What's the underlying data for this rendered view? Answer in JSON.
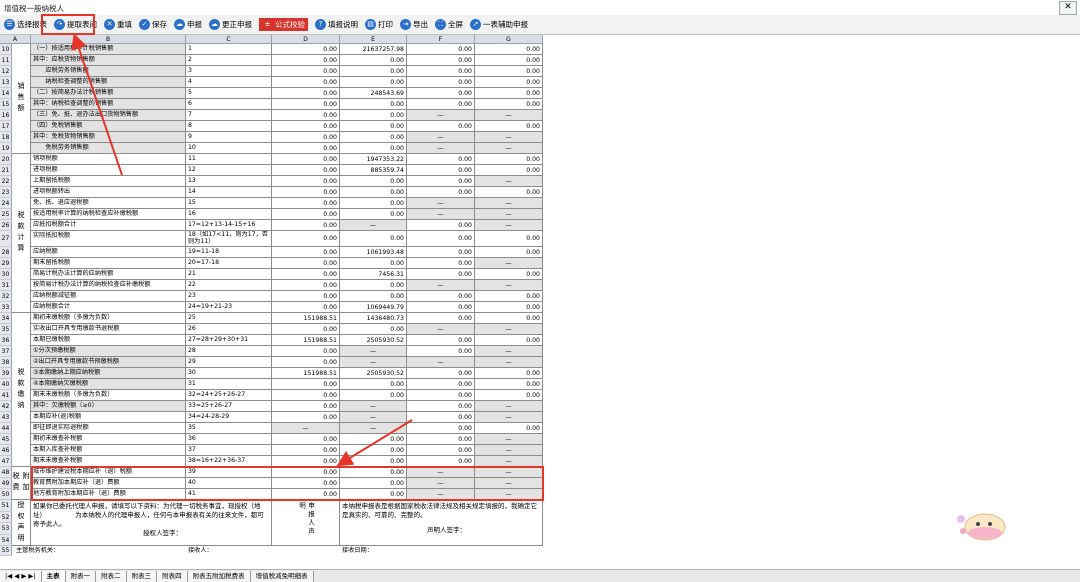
{
  "window": {
    "title": "增值税一般纳税人",
    "close_glyph": "✕"
  },
  "toolbar": [
    {
      "name": "select-report-button",
      "label": "选择报表",
      "icon": "list-icon",
      "color": "#2a6fc9"
    },
    {
      "name": "fetch-report-button",
      "label": "提取表间",
      "icon": "share-arrow-icon",
      "color": "#2a6fc9"
    },
    {
      "name": "refill-button",
      "label": "重填",
      "icon": "close-circle-icon",
      "color": "#2a6fc9"
    },
    {
      "name": "save-button",
      "label": "保存",
      "icon": "check-circle-icon",
      "color": "#2a6fc9"
    },
    {
      "name": "declare-button",
      "label": "申报",
      "icon": "cloud-icon",
      "color": "#2a6fc9"
    },
    {
      "name": "correct-declare-button",
      "label": "更正申报",
      "icon": "cloud-icon",
      "color": "#2a6fc9"
    },
    {
      "name": "formula-check-button",
      "label": "公式校验",
      "icon": "formula-icon",
      "color": "#d9342b"
    },
    {
      "name": "fill-help-button",
      "label": "填报说明",
      "icon": "question-icon",
      "color": "#2a6fc9"
    },
    {
      "name": "print-button",
      "label": "打印",
      "icon": "printer-icon",
      "color": "#2a6fc9"
    },
    {
      "name": "export-button",
      "label": "导出",
      "icon": "export-icon",
      "color": "#2a6fc9"
    },
    {
      "name": "fullscreen-button",
      "label": "全屏",
      "icon": "fullscreen-icon",
      "color": "#2a6fc9"
    },
    {
      "name": "auxiliary-declare-button",
      "label": "一表辅助申报",
      "icon": "expand-icon",
      "color": "#2a6fc9"
    }
  ],
  "columns": [
    "A",
    "B",
    "C",
    "D",
    "E",
    "F",
    "G"
  ],
  "categories": [
    {
      "label": "销售额",
      "from": 0,
      "to": 9
    },
    {
      "label": "税款计算",
      "from": 10,
      "to": 23
    },
    {
      "label": "税款缴纳",
      "from": 24,
      "to": 37
    },
    {
      "label": "附加税费",
      "from": 38,
      "to": 40
    }
  ],
  "rows": [
    {
      "n": "10",
      "b": "（一）按适用税率计税销售额",
      "c": "1",
      "d": "0.00",
      "e": "21637257.98",
      "f": "0.00",
      "g": "0.00"
    },
    {
      "n": "11",
      "b": "其中：应税货物销售额",
      "c": "2",
      "d": "0.00",
      "e": "0.00",
      "f": "0.00",
      "g": "0.00"
    },
    {
      "n": "12",
      "b": "　　应税劳务销售额",
      "c": "3",
      "d": "0.00",
      "e": "0.00",
      "f": "0.00",
      "g": "0.00"
    },
    {
      "n": "13",
      "b": "　　纳税检查调整的销售额",
      "c": "4",
      "d": "0.00",
      "e": "0.00",
      "f": "0.00",
      "g": "0.00"
    },
    {
      "n": "14",
      "b": "（二）按简易办法计税销售额",
      "c": "5",
      "d": "0.00",
      "e": "248543.69",
      "f": "0.00",
      "g": "0.00"
    },
    {
      "n": "15",
      "b": "其中：纳税检查调整的销售额",
      "c": "6",
      "d": "0.00",
      "e": "0.00",
      "f": "0.00",
      "g": "0.00"
    },
    {
      "n": "16",
      "b": "（三）免、抵、退办法出口货物销售额",
      "c": "7",
      "d": "0.00",
      "e": "0.00",
      "f": "—",
      "g": "—"
    },
    {
      "n": "17",
      "b": "（四）免税销售额",
      "c": "8",
      "d": "0.00",
      "e": "0.00",
      "f": "0.00",
      "g": "0.00"
    },
    {
      "n": "18",
      "b": "其中：免税货物销售额",
      "c": "9",
      "d": "0.00",
      "e": "0.00",
      "f": "—",
      "g": "—"
    },
    {
      "n": "19",
      "b": "　　免税劳务销售额",
      "c": "10",
      "d": "0.00",
      "e": "0.00",
      "f": "—",
      "g": "—"
    },
    {
      "n": "20",
      "b": "销项税额",
      "c": "11",
      "d": "0.00",
      "e": "1947353.22",
      "f": "0.00",
      "g": "0.00"
    },
    {
      "n": "21",
      "b": "进项税额",
      "c": "12",
      "d": "0.00",
      "e": "885359.74",
      "f": "0.00",
      "g": "0.00"
    },
    {
      "n": "22",
      "b": "上期留抵税额",
      "c": "13",
      "d": "0.00",
      "e": "0.00",
      "f": "0.00",
      "g": "—"
    },
    {
      "n": "23",
      "b": "进项税额转出",
      "c": "14",
      "d": "0.00",
      "e": "0.00",
      "f": "0.00",
      "g": "0.00"
    },
    {
      "n": "24",
      "b": "免、抵、退应退税额",
      "c": "15",
      "d": "0.00",
      "e": "0.00",
      "f": "—",
      "g": "—"
    },
    {
      "n": "25",
      "b": "按适用税率计算的纳税检查应补缴税额",
      "c": "16",
      "d": "0.00",
      "e": "0.00",
      "f": "—",
      "g": "—"
    },
    {
      "n": "26",
      "b": "应抵扣税额合计",
      "c": "17=12+13-14-15+16",
      "d": "0.00",
      "e": "—",
      "f": "0.00",
      "g": "—"
    },
    {
      "n": "27",
      "b": "实际抵扣税额",
      "c": "18（如17<11，则为17，否则为11）",
      "d": "0.00",
      "e": "0.00",
      "f": "0.00",
      "g": "0.00",
      "tall": true
    },
    {
      "n": "28",
      "b": "应纳税额",
      "c": "19=11-18",
      "d": "0.00",
      "e": "1061993.48",
      "f": "0.00",
      "g": "0.00"
    },
    {
      "n": "29",
      "b": "期末留抵税额",
      "c": "20=17-18",
      "d": "0.00",
      "e": "0.00",
      "f": "0.00",
      "g": "—"
    },
    {
      "n": "30",
      "b": "简易计税办法计算的应纳税额",
      "c": "21",
      "d": "0.00",
      "e": "7456.31",
      "f": "0.00",
      "g": "0.00"
    },
    {
      "n": "31",
      "b": "按简易计税办法计算的纳税检查应补缴税额",
      "c": "22",
      "d": "0.00",
      "e": "0.00",
      "f": "—",
      "g": "—"
    },
    {
      "n": "32",
      "b": "应纳税额减征额",
      "c": "23",
      "d": "0.00",
      "e": "0.00",
      "f": "0.00",
      "g": "0.00"
    },
    {
      "n": "33",
      "b": "应纳税额合计",
      "c": "24=19+21-23",
      "d": "0.00",
      "e": "1069449.79",
      "f": "0.00",
      "g": "0.00"
    },
    {
      "n": "34",
      "b": "期初未缴税额（多缴为负数）",
      "c": "25",
      "d": "151988.51",
      "e": "1436480.73",
      "f": "0.00",
      "g": "0.00"
    },
    {
      "n": "35",
      "b": "实收出口开具专用缴款书退税额",
      "c": "26",
      "d": "0.00",
      "e": "0.00",
      "f": "—",
      "g": "—"
    },
    {
      "n": "36",
      "b": "本期已缴税额",
      "c": "27=28+29+30+31",
      "d": "151988.51",
      "e": "2505930.52",
      "f": "0.00",
      "g": "0.00"
    },
    {
      "n": "37",
      "b": "①分次预缴税额",
      "c": "28",
      "d": "0.00",
      "e": "—",
      "f": "0.00",
      "g": "—"
    },
    {
      "n": "38",
      "b": "②出口开具专用缴款书预缴税额",
      "c": "29",
      "d": "0.00",
      "e": "—",
      "f": "—",
      "g": "—"
    },
    {
      "n": "39",
      "b": "③本期缴纳上期应纳税额",
      "c": "30",
      "d": "151988.51",
      "e": "2505930.52",
      "f": "0.00",
      "g": "0.00"
    },
    {
      "n": "40",
      "b": "④本期缴纳欠缴税额",
      "c": "31",
      "d": "0.00",
      "e": "0.00",
      "f": "0.00",
      "g": "0.00"
    },
    {
      "n": "41",
      "b": "期末未缴税额（多缴为负数）",
      "c": "32=24+25+26-27",
      "d": "0.00",
      "e": "0.00",
      "f": "0.00",
      "g": "0.00"
    },
    {
      "n": "42",
      "b": "其中：欠缴税额（≥0）",
      "c": "33=25+26-27",
      "d": "0.00",
      "e": "—",
      "f": "0.00",
      "g": "—"
    },
    {
      "n": "43",
      "b": "本期应补(退)税额",
      "c": "34=24-28-29",
      "d": "0.00",
      "e": "—",
      "f": "0.00",
      "g": "—"
    },
    {
      "n": "44",
      "b": "即征即退实际退税额",
      "c": "35",
      "d": "—",
      "e": "—",
      "f": "0.00",
      "g": "0.00"
    },
    {
      "n": "45",
      "b": "期初未缴查补税额",
      "c": "36",
      "d": "0.00",
      "e": "0.00",
      "f": "0.00",
      "g": "—"
    },
    {
      "n": "46",
      "b": "本期入库查补税额",
      "c": "37",
      "d": "0.00",
      "e": "0.00",
      "f": "0.00",
      "g": "—"
    },
    {
      "n": "47",
      "b": "期末未缴查补税额",
      "c": "38=16+22+36-37",
      "d": "0.00",
      "e": "0.00",
      "f": "0.00",
      "g": "—"
    },
    {
      "n": "48",
      "b": "城市维护建设税本期应补（退）税额",
      "c": "39",
      "d": "0.00",
      "e": "0.00",
      "f": "—",
      "g": "—"
    },
    {
      "n": "49",
      "b": "教育费附加本期应补（退）费额",
      "c": "40",
      "d": "0.00",
      "e": "0.00",
      "f": "—",
      "g": "—"
    },
    {
      "n": "50",
      "b": "地方教育附加本期应补（退）费额",
      "c": "41",
      "d": "0.00",
      "e": "0.00",
      "f": "—",
      "g": "—"
    }
  ],
  "declaration": {
    "rownums": [
      "51",
      "52",
      "53",
      "54"
    ],
    "cat_label": "授权声明",
    "left_text": "如果你已委托代理人申报，请填写以下资料：为代理一切税务事宜，现授权（地址）　　　　　为本纳税人的代理申报人，任何与本申报表有关的往来文件，都可寄予此人。",
    "auth_sign": "授权人签字：",
    "mid_label": "申报人声明",
    "right_text": "本纳税申报表是根据国家税收法律法规及相关规定填报的，我确定它是真实的、可靠的、完整的。",
    "decl_sign": "声明人签字："
  },
  "footer": {
    "rownum": "55",
    "tax_office": "主管税务机关：",
    "receiver": "接收人：",
    "receive_date": "接收日期："
  },
  "tabs": [
    {
      "label": "主表",
      "active": true
    },
    {
      "label": "附表一"
    },
    {
      "label": "附表二"
    },
    {
      "label": "附表三"
    },
    {
      "label": "附表四"
    },
    {
      "label": "附表五附加税费表"
    },
    {
      "label": "增值税减免明细表"
    }
  ],
  "tab_nav": "|◀ ◀ ▶ ▶|",
  "colors": {
    "highlight_red": "#e8352a",
    "header_blue": "#d8dde6",
    "gray_cell": "#e3e3e3"
  }
}
